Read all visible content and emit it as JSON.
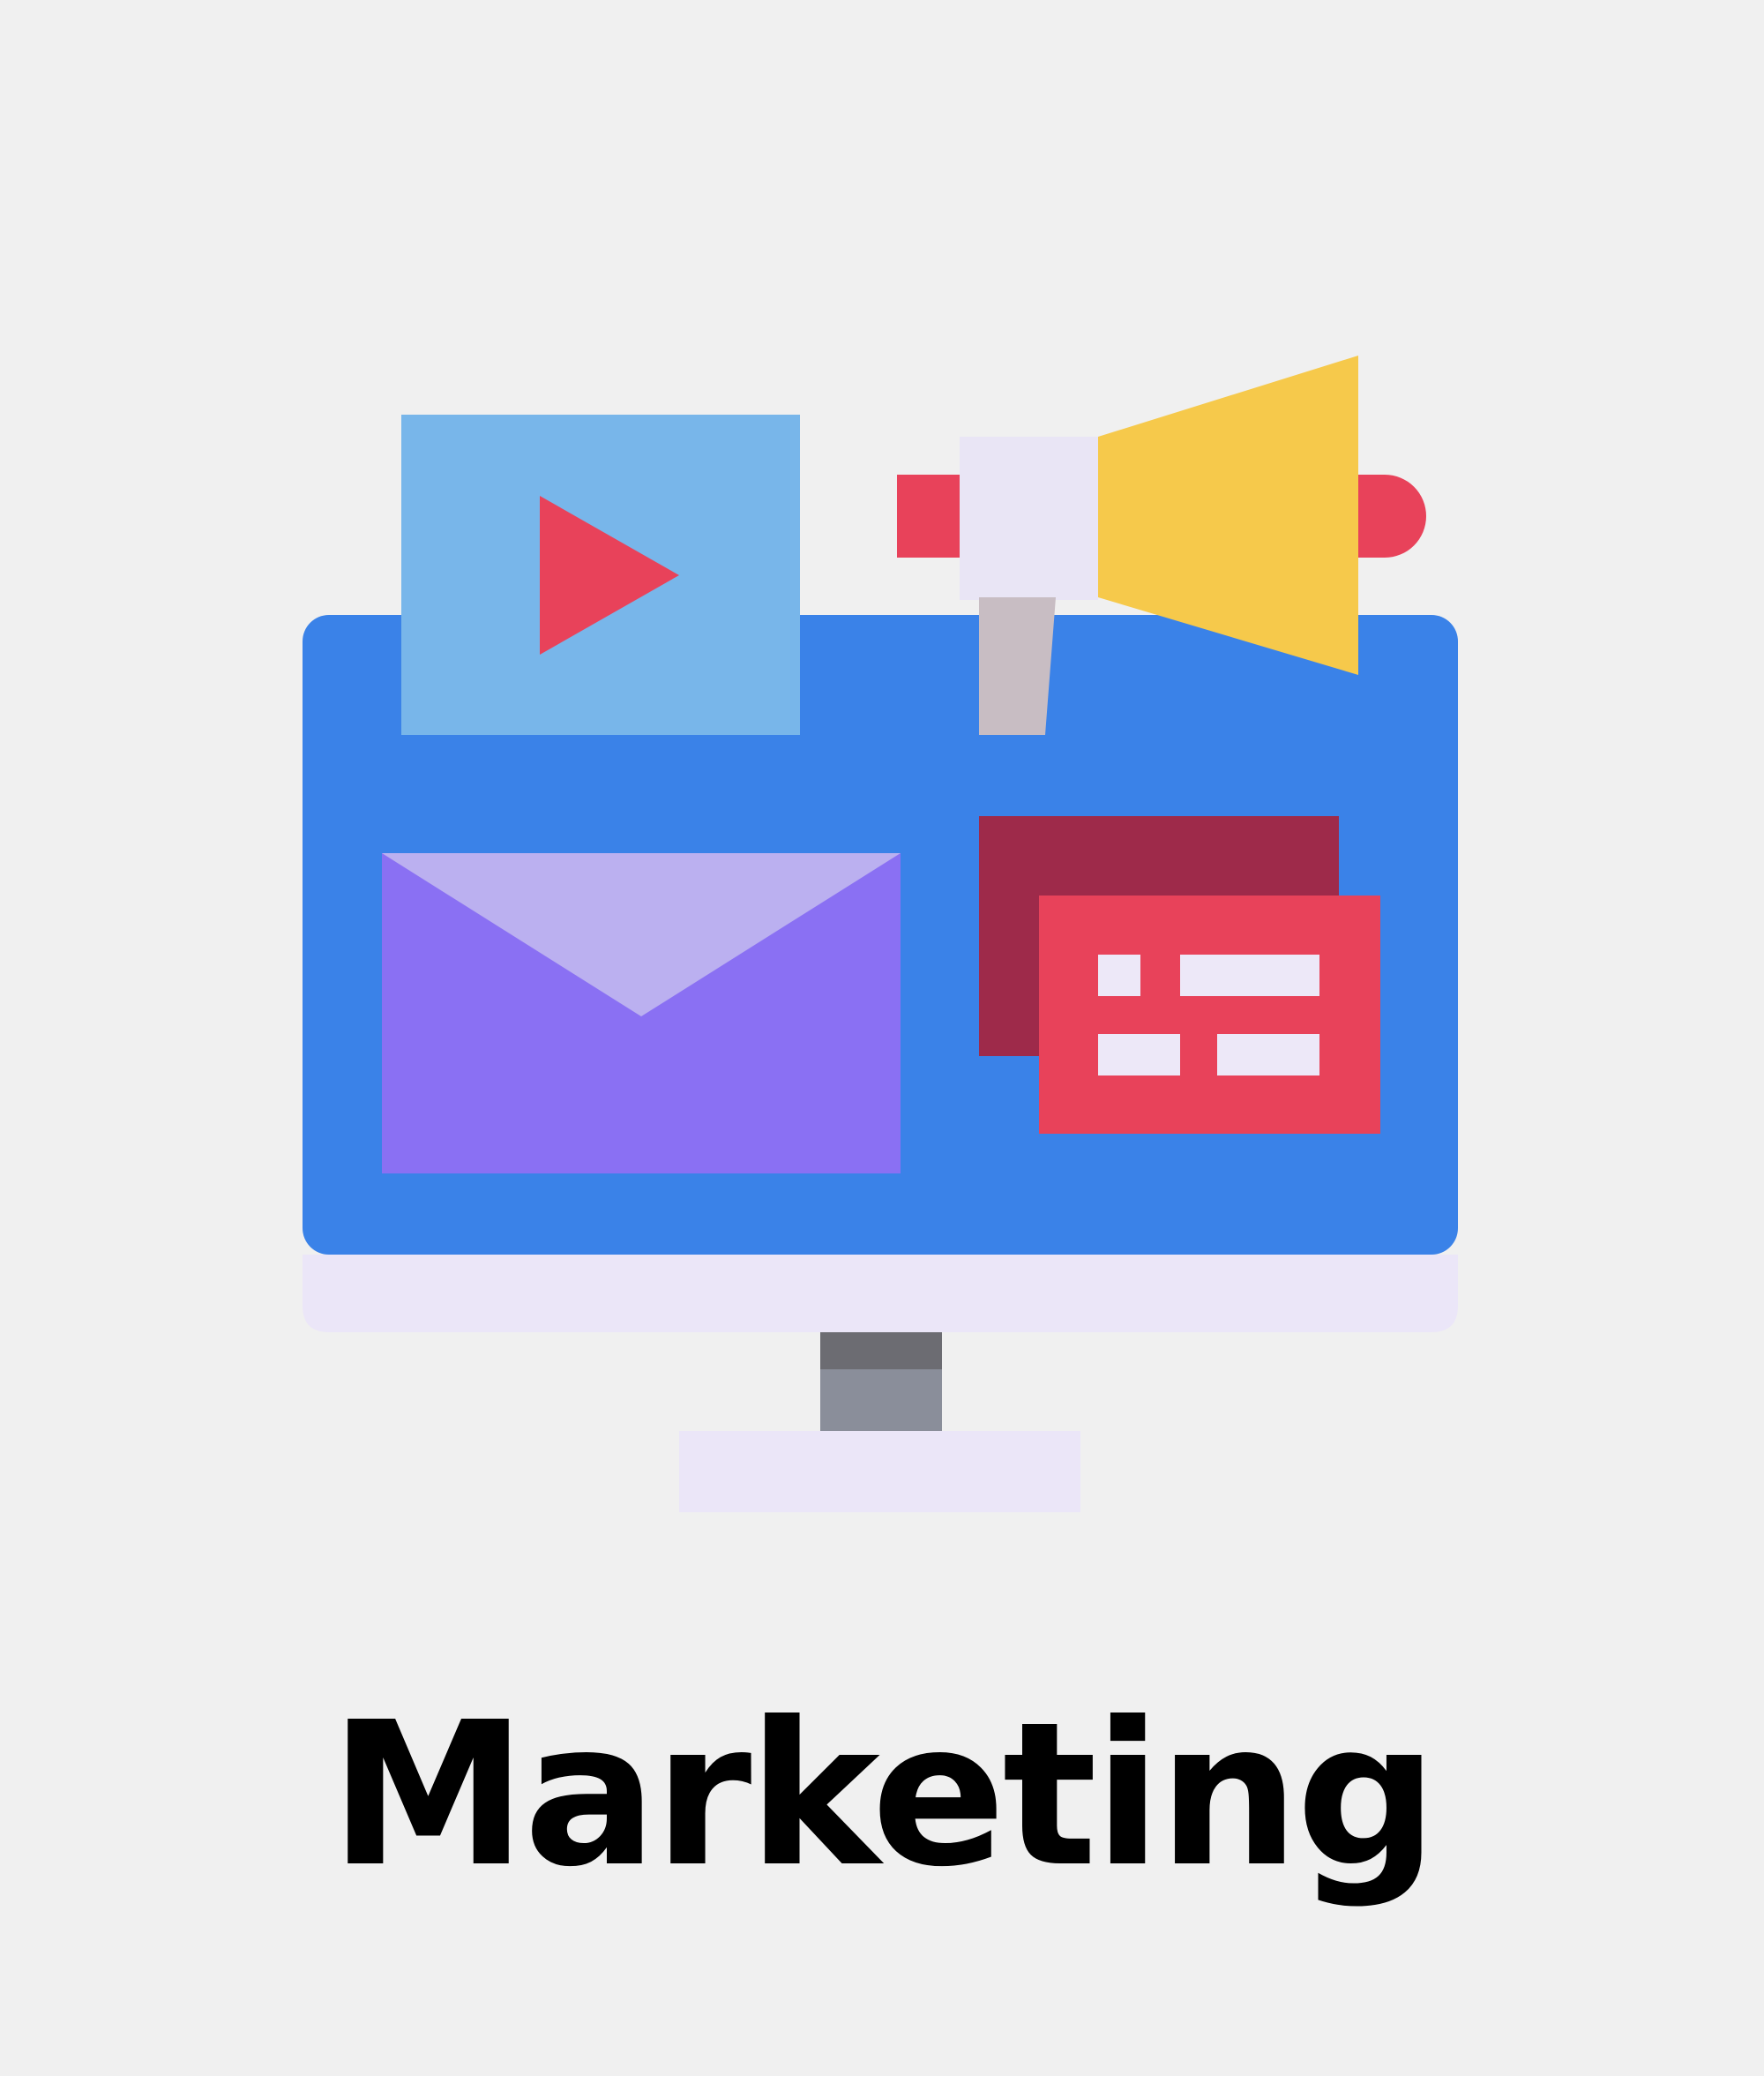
{
  "app_tile": {
    "label": "Marketing",
    "icon": "marketing-monitor-megaphone-icon"
  },
  "colors": {
    "background": "#f0f0f0",
    "monitor_screen": "#3a82e8",
    "monitor_bezel": "#ebe6f8",
    "stand_neck": "#8a8e9a",
    "video_panel": "#78b6ea",
    "play_triangle": "#e8425a",
    "megaphone_cone": "#f6c94b",
    "megaphone_body": "#e9e5f5",
    "megaphone_handle": "#c8bdc3",
    "envelope": "#8a70f3",
    "envelope_flap": "#bbb0f0",
    "card_back": "#9e2a4a",
    "card_front": "#e8425a",
    "card_lines": "#ede8f8",
    "label_text": "#000000"
  }
}
